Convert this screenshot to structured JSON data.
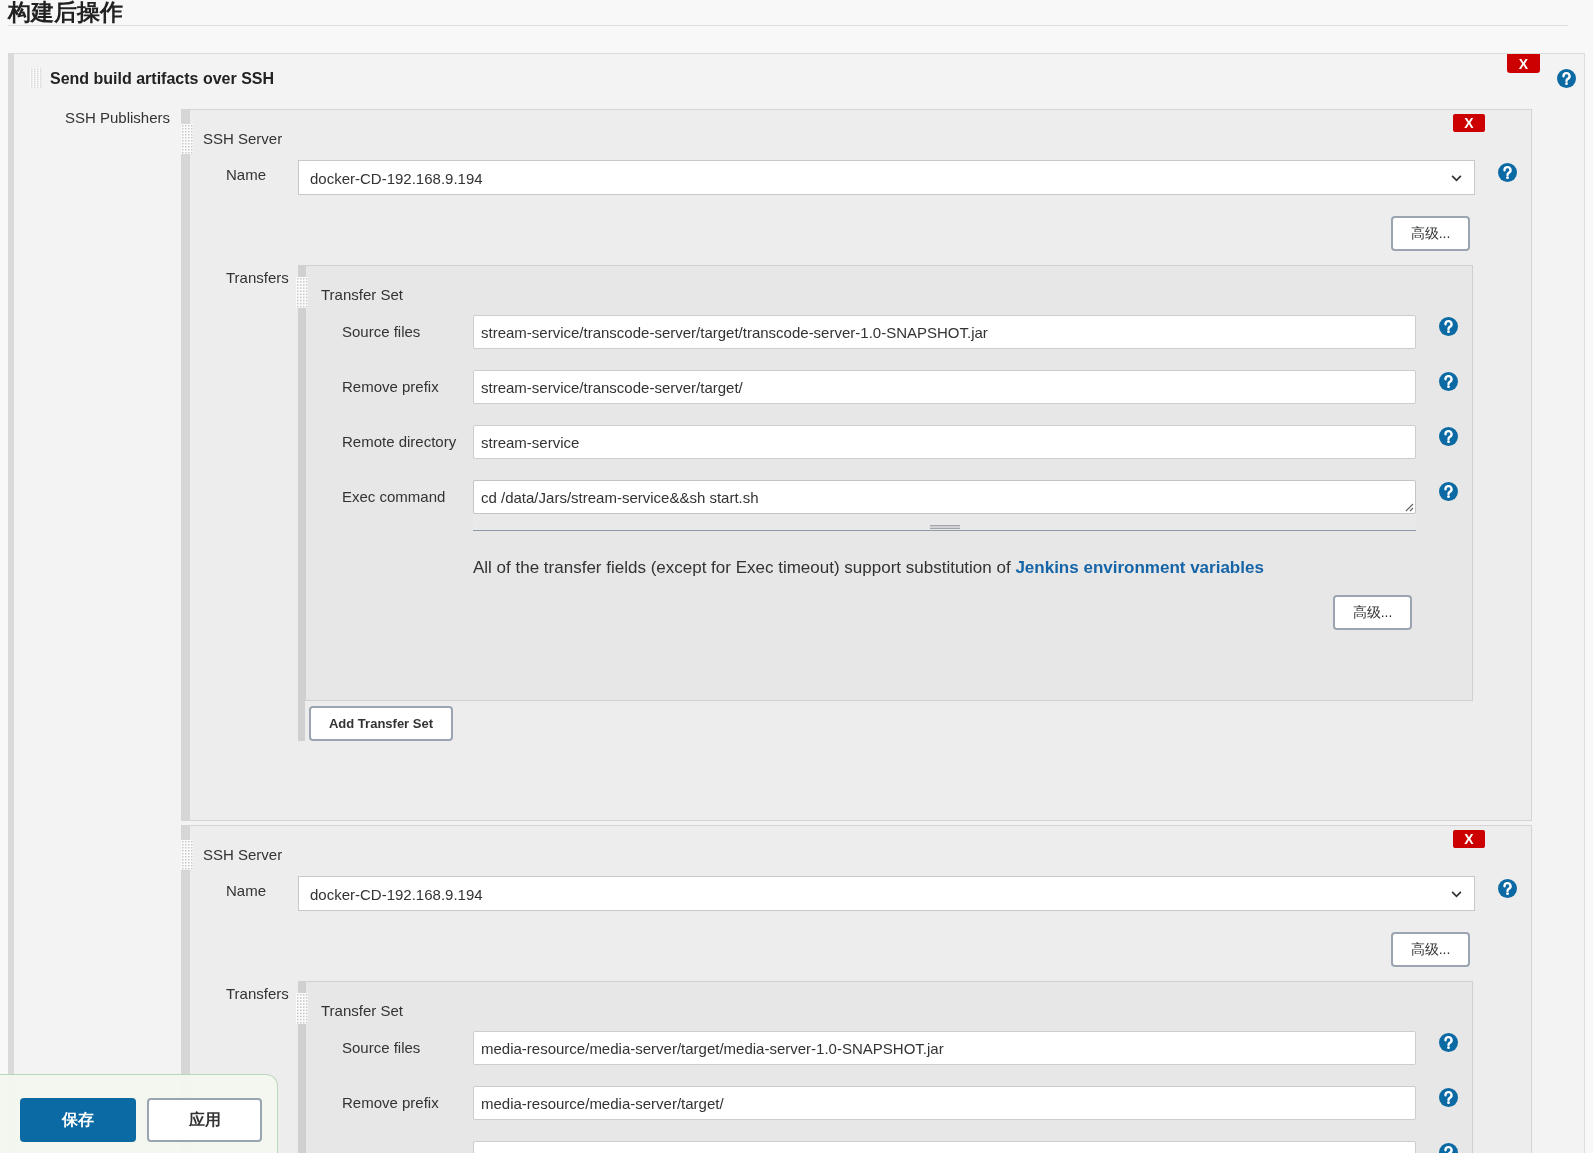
{
  "page_title": "构建后操作",
  "publisher": {
    "title": "Send build artifacts over SSH",
    "delete_button": "X",
    "label": "SSH Publishers",
    "servers": [
      {
        "title": "SSH Server",
        "delete_button": "X",
        "name_label": "Name",
        "name_value": "docker-CD-192.168.9.194",
        "advanced_button": "高级...",
        "transfers_label": "Transfers",
        "transfer_sets": [
          {
            "title": "Transfer Set",
            "fields": [
              {
                "kind": "input",
                "label": "Source files",
                "value": "stream-service/transcode-server/target/transcode-server-1.0-SNAPSHOT.jar"
              },
              {
                "kind": "input",
                "label": "Remove prefix",
                "value": "stream-service/transcode-server/target/"
              },
              {
                "kind": "input",
                "label": "Remote directory",
                "value": "stream-service"
              },
              {
                "kind": "textarea",
                "label": "Exec command",
                "value": "cd /data/Jars/stream-service&&sh start.sh"
              }
            ],
            "note": "All of the transfer fields (except for Exec timeout) support substitution of",
            "note_link": "Jenkins environment variables",
            "advanced_button": "高级..."
          }
        ],
        "add_button": "Add Transfer Set"
      },
      {
        "title": "SSH Server",
        "delete_button": "X",
        "name_label": "Name",
        "name_value": "docker-CD-192.168.9.194",
        "advanced_button": "高级...",
        "transfers_label": "Transfers",
        "transfer_sets": [
          {
            "title": "Transfer Set",
            "fields": [
              {
                "kind": "input",
                "label": "Source files",
                "value": "media-resource/media-server/target/media-server-1.0-SNAPSHOT.jar"
              },
              {
                "kind": "input",
                "label": "Remove prefix",
                "value": "media-resource/media-server/target/"
              },
              {
                "kind": "input"
              }
            ]
          }
        ]
      }
    ]
  },
  "actions": [
    {
      "label": "保存",
      "kind": "primary"
    },
    {
      "label": "应用",
      "kind": "secondary"
    }
  ]
}
